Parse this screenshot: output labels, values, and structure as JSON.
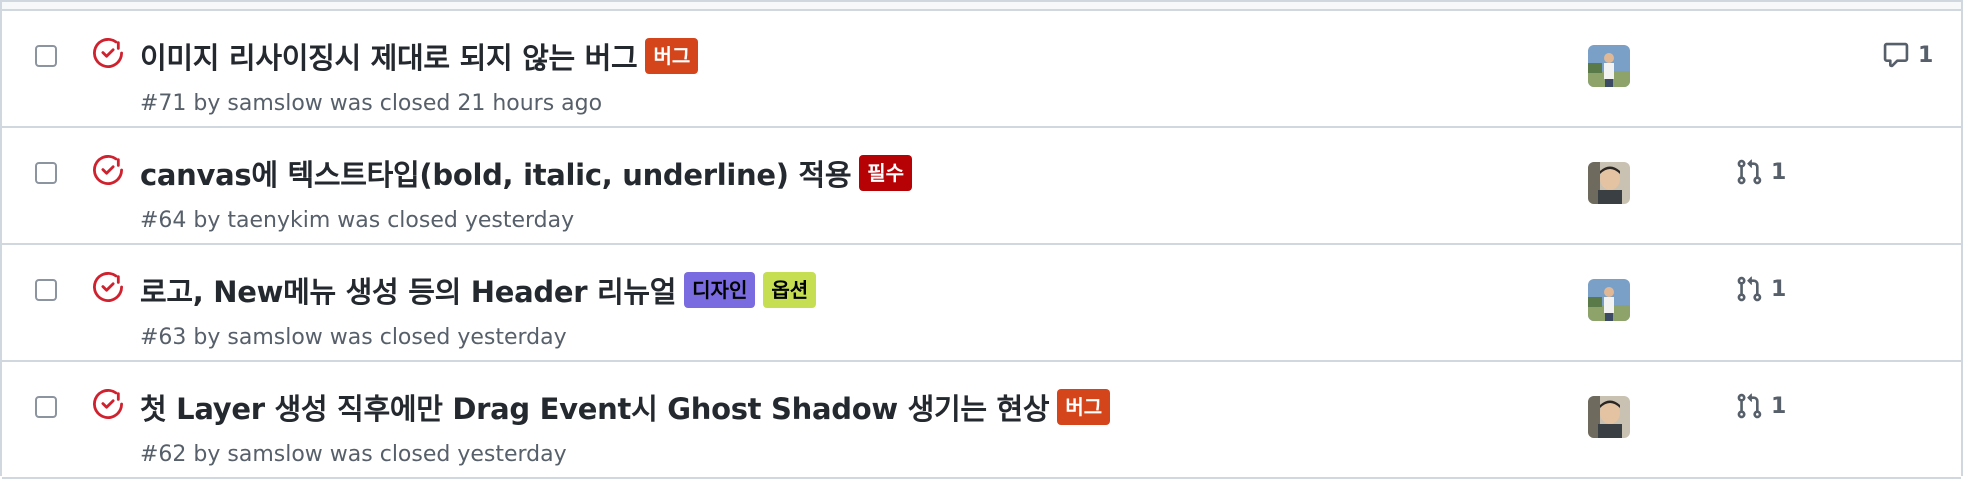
{
  "colors": {
    "closed_icon": "#cf222e",
    "label_bug": "#d4451b",
    "label_required": "#b60205",
    "label_design": "#7b6be0",
    "label_option": "#c5de52"
  },
  "issues": [
    {
      "title": "이미지 리사이징시 제대로 되지 않는 버그",
      "labels": [
        {
          "text": "버그",
          "bg": "#d4451b",
          "fg": "#ffffff"
        }
      ],
      "meta": "#71 by samslow was closed 21 hours ago",
      "avatar": "samslow",
      "counter_type": "comment",
      "counter": "1"
    },
    {
      "title": "canvas에 텍스트타입(bold, italic, underline) 적용",
      "labels": [
        {
          "text": "필수",
          "bg": "#b60205",
          "fg": "#ffffff"
        }
      ],
      "meta": "#64 by taenykim was closed yesterday",
      "avatar": "taenykim",
      "counter_type": "pull-request",
      "counter": "1"
    },
    {
      "title": "로고, New메뉴 생성 등의 Header 리뉴얼",
      "labels": [
        {
          "text": "디자인",
          "bg": "#7b6be0",
          "fg": "#000000"
        },
        {
          "text": "옵션",
          "bg": "#c5de52",
          "fg": "#000000"
        }
      ],
      "meta": "#63 by samslow was closed yesterday",
      "avatar": "samslow",
      "counter_type": "pull-request",
      "counter": "1"
    },
    {
      "title": "첫 Layer 생성 직후에만 Drag Event시 Ghost Shadow 생기는 현상",
      "labels": [
        {
          "text": "버그",
          "bg": "#d4451b",
          "fg": "#ffffff"
        }
      ],
      "meta": "#62 by samslow was closed yesterday",
      "avatar": "taenykim",
      "counter_type": "pull-request",
      "counter": "1"
    }
  ]
}
